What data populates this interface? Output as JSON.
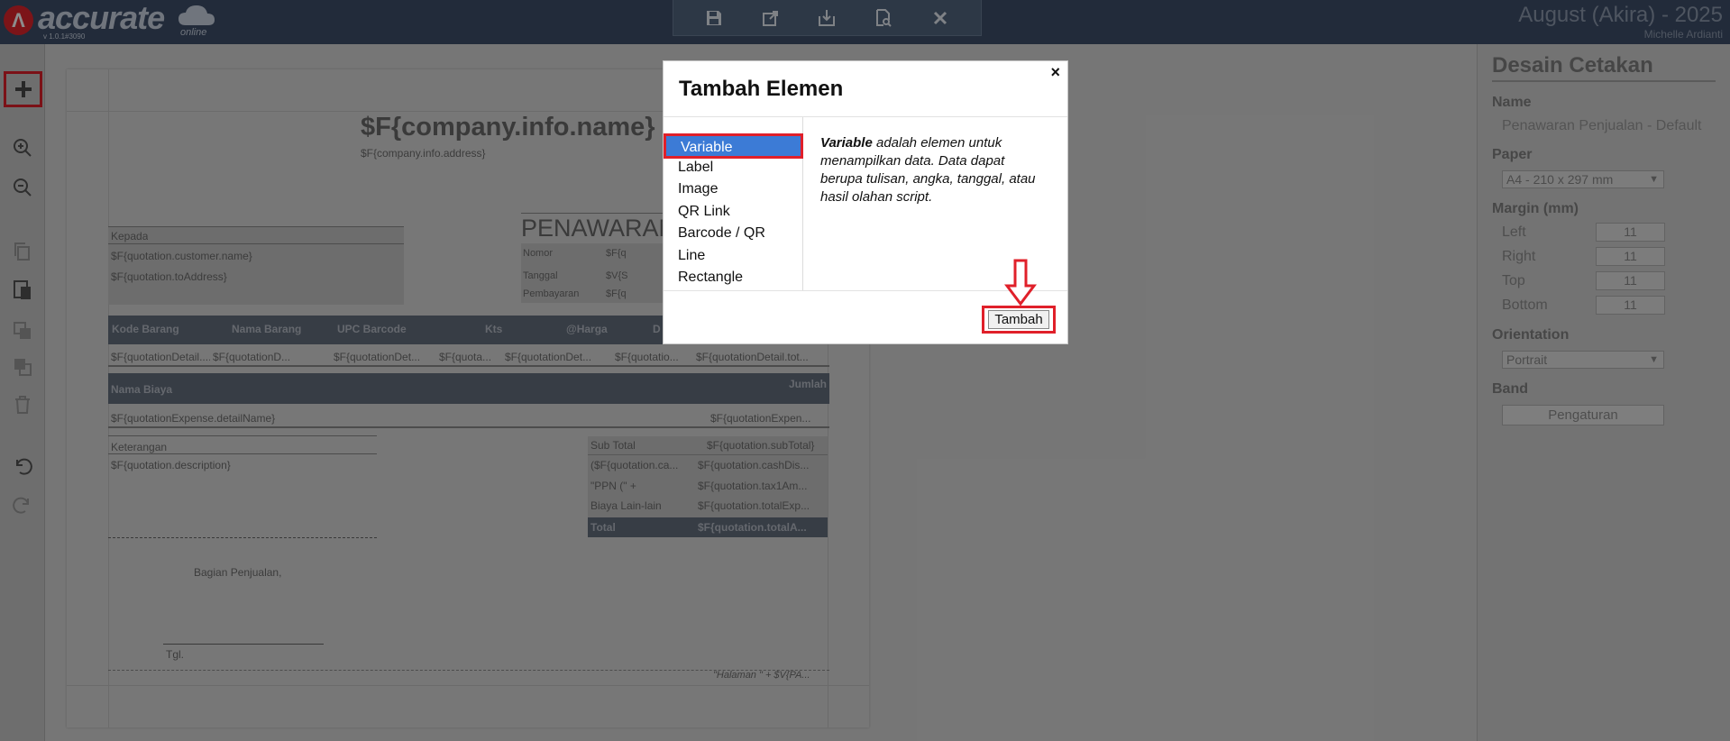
{
  "app": {
    "logo_text": "accurate",
    "logo_sub": "online",
    "version": "v 1.0.1#3090",
    "period": "August (Akira) - 2025",
    "user": "Michelle Ardianti"
  },
  "toolbar": {
    "icons": [
      "save-icon",
      "export-icon",
      "import-icon",
      "preview-icon",
      "close-icon"
    ]
  },
  "left_tools": [
    "add-icon",
    "zoom-in-icon",
    "zoom-out-icon",
    "copy-icon",
    "paste-icon",
    "bring-front-icon",
    "send-back-icon",
    "delete-icon",
    "undo-icon",
    "redo-icon"
  ],
  "document": {
    "company_name": "$F{company.info.name}",
    "company_address": "$F{company.info.address}",
    "kepada_label": "Kepada",
    "customer_name": "$F{quotation.customer.name}",
    "to_address": "$F{quotation.toAddress}",
    "doc_title": "PENAWARAN",
    "nomor_label": "Nomor",
    "tanggal_label": "Tanggal",
    "pembayaran_label": "Pembayaran",
    "nomor_value": "$F{q",
    "tanggal_value": "$V{S",
    "pembayaran_value": "$F{q",
    "detail_headers": [
      "Kode Barang",
      "Nama Barang",
      "UPC Barcode",
      "Kts",
      "@Harga",
      "D"
    ],
    "detail_row": [
      "$F{quotationDetail....",
      "$F{quotationD...",
      "$F{quotationDet...",
      "$F{quota...",
      "$F{quotationDet...",
      "$F{quotatio...",
      "$F{quotationDetail.tot..."
    ],
    "biaya_header": "Nama Biaya",
    "jumlah_header": "Jumlah",
    "expense_name": "$F{quotationExpense.detailName}",
    "expense_value": "$F{quotationExpen...",
    "keterangan_label": "Keterangan",
    "description": "$F{quotation.description}",
    "subtotal_label": "Sub Total",
    "subtotal_value": "$F{quotation.subTotal}",
    "cash_label": "($F{quotation.ca...",
    "cash_value": "$F{quotation.cashDis...",
    "ppn_label": "\"PPN (\" +",
    "ppn_value": "$F{quotation.tax1Am...",
    "biaya_lain_label": "Biaya Lain-lain",
    "biaya_lain_value": "$F{quotation.totalExp...",
    "total_label": "Total",
    "total_value": "$F{quotation.totalA...",
    "signature_label": "Bagian Penjualan,",
    "tgl_label": "Tgl.",
    "page_footer": "\"Halaman \" + $V{PA..."
  },
  "right_panel": {
    "title": "Desain Cetakan",
    "name_label": "Name",
    "name_value": "Penawaran Penjualan - Default",
    "paper_label": "Paper",
    "paper_value": "A4 - 210 x 297 mm",
    "margin_label": "Margin (mm)",
    "margins": [
      {
        "label": "Left",
        "value": "11"
      },
      {
        "label": "Right",
        "value": "11"
      },
      {
        "label": "Top",
        "value": "11"
      },
      {
        "label": "Bottom",
        "value": "11"
      }
    ],
    "orientation_label": "Orientation",
    "orientation_value": "Portrait",
    "band_label": "Band",
    "band_button": "Pengaturan"
  },
  "modal": {
    "title": "Tambah Elemen",
    "close": "×",
    "items": [
      "Variable",
      "Label",
      "Image",
      "QR Link",
      "Barcode / QR",
      "Line",
      "Rectangle"
    ],
    "selected_index": 0,
    "desc_bold": "Variable",
    "desc_rest": " adalah elemen untuk menampilkan data. Data dapat berupa tulisan, angka, tanggal, atau hasil olahan script.",
    "add_button": "Tambah"
  }
}
